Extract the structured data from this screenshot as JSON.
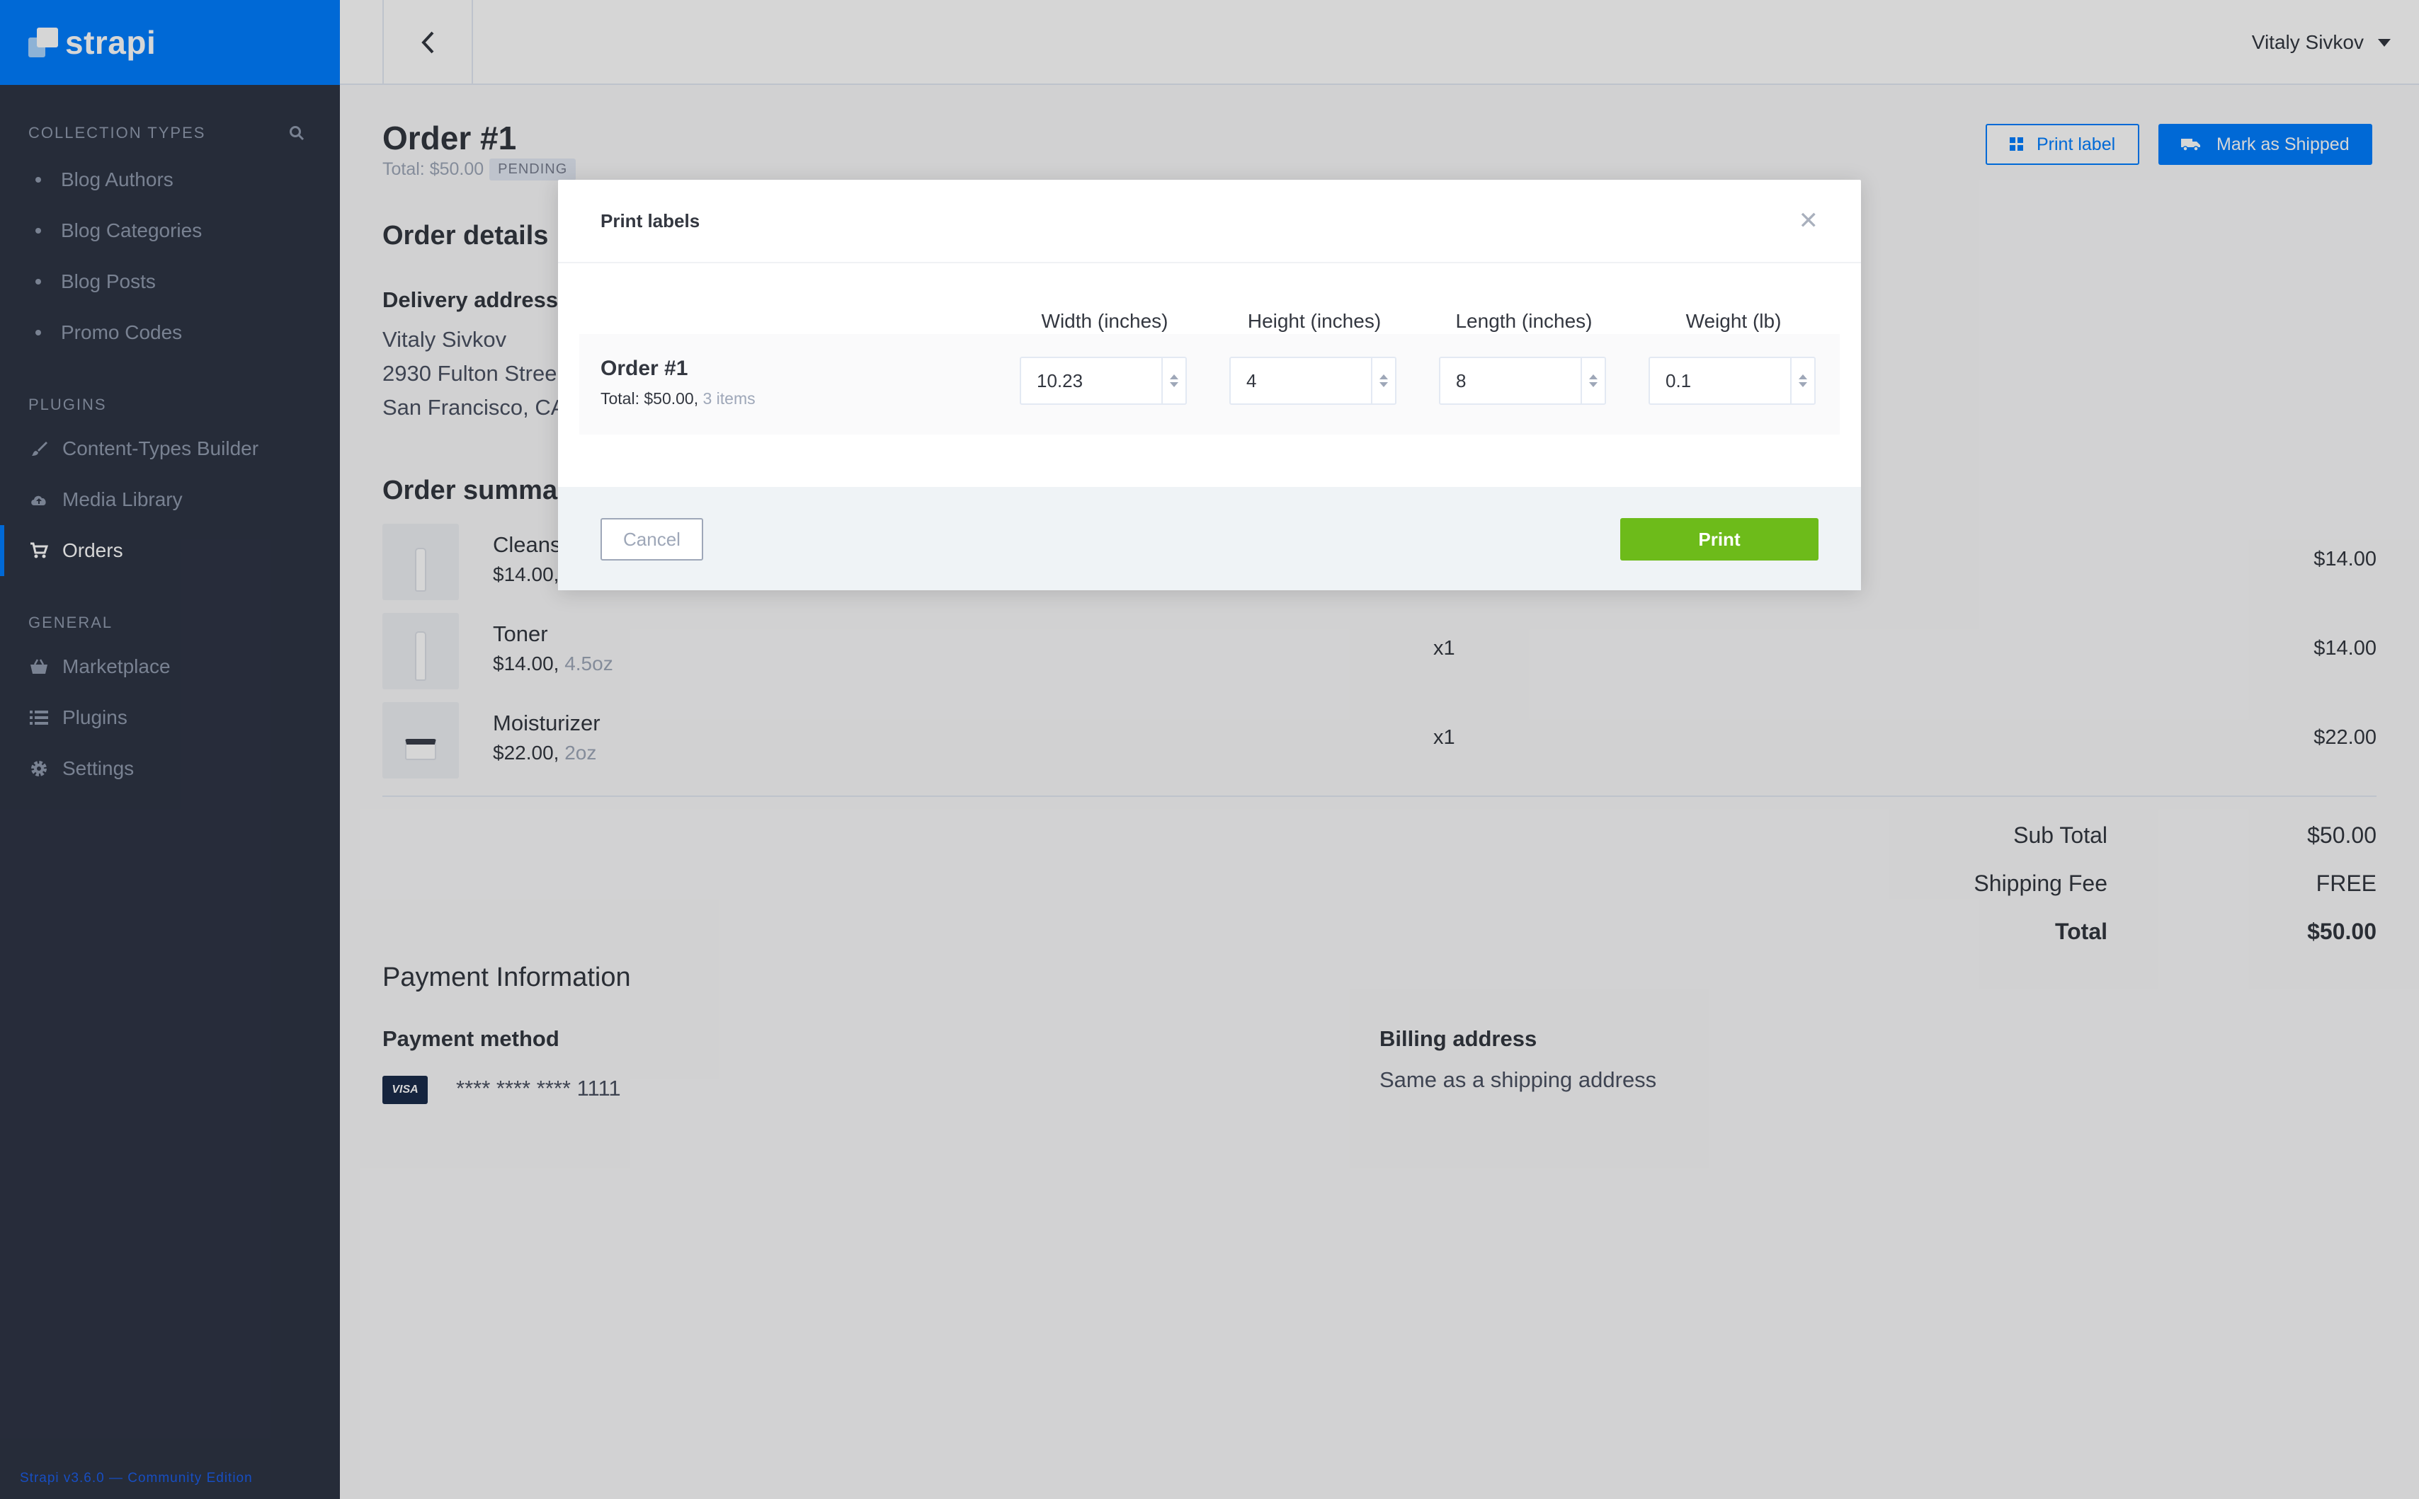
{
  "brand": {
    "name": "strapi"
  },
  "sidebar": {
    "collection_types": {
      "title": "Collection Types",
      "items": [
        {
          "label": "Blog Authors"
        },
        {
          "label": "Blog Categories"
        },
        {
          "label": "Blog Posts"
        },
        {
          "label": "Promo Codes"
        }
      ]
    },
    "plugins": {
      "title": "Plugins",
      "items": [
        {
          "label": "Content-Types Builder",
          "icon": "paint-brush-icon"
        },
        {
          "label": "Media Library",
          "icon": "cloud-upload-icon"
        },
        {
          "label": "Orders",
          "icon": "shopping-cart-icon",
          "active": true
        }
      ]
    },
    "general": {
      "title": "General",
      "items": [
        {
          "label": "Marketplace",
          "icon": "basket-icon"
        },
        {
          "label": "Plugins",
          "icon": "list-icon"
        },
        {
          "label": "Settings",
          "icon": "gear-icon"
        }
      ]
    },
    "footer": "Strapi v3.6.0 — Community Edition"
  },
  "header": {
    "user_name": "Vitaly Sivkov"
  },
  "page": {
    "title": "Order #1",
    "total_text": "Total: $50.00",
    "status": "PENDING",
    "print_label_button": "Print label",
    "mark_shipped_button": "Mark as Shipped"
  },
  "order_details": {
    "heading": "Order details",
    "delivery_heading": "Delivery address",
    "address_lines": [
      "Vitaly Sivkov",
      "2930 Fulton Stree",
      "San Francisco, CA"
    ]
  },
  "order_summary": {
    "heading": "Order summar",
    "items": [
      {
        "name": "Cleans",
        "price": "$14.00,",
        "size": "",
        "qty": "",
        "total": "$14.00"
      },
      {
        "name": "Toner",
        "price": "$14.00,",
        "size": "4.5oz",
        "qty": "x1",
        "total": "$14.00"
      },
      {
        "name": "Moisturizer",
        "price": "$22.00,",
        "size": "2oz",
        "qty": "x1",
        "total": "$22.00"
      }
    ],
    "subtotal_label": "Sub Total",
    "subtotal_value": "$50.00",
    "shipping_label": "Shipping Fee",
    "shipping_value": "FREE",
    "total_label": "Total",
    "total_value": "$50.00"
  },
  "payment": {
    "heading": "Payment Information",
    "method_heading": "Payment method",
    "card_brand": "VISA",
    "card_number": "**** **** **** 1111",
    "billing_heading": "Billing address",
    "billing_text": "Same as a shipping address"
  },
  "modal": {
    "title": "Print labels",
    "columns": [
      "Width (inches)",
      "Height (inches)",
      "Length (inches)",
      "Weight (lb)"
    ],
    "row": {
      "order": "Order #1",
      "total": "Total: $50.00,",
      "items": "3 items",
      "values": [
        "10.23",
        "4",
        "8",
        "0.1"
      ]
    },
    "cancel_button": "Cancel",
    "print_button": "Print"
  },
  "colors": {
    "primary": "#007eff",
    "sidebar": "#2e3545",
    "print_green": "#6dbb1a"
  }
}
